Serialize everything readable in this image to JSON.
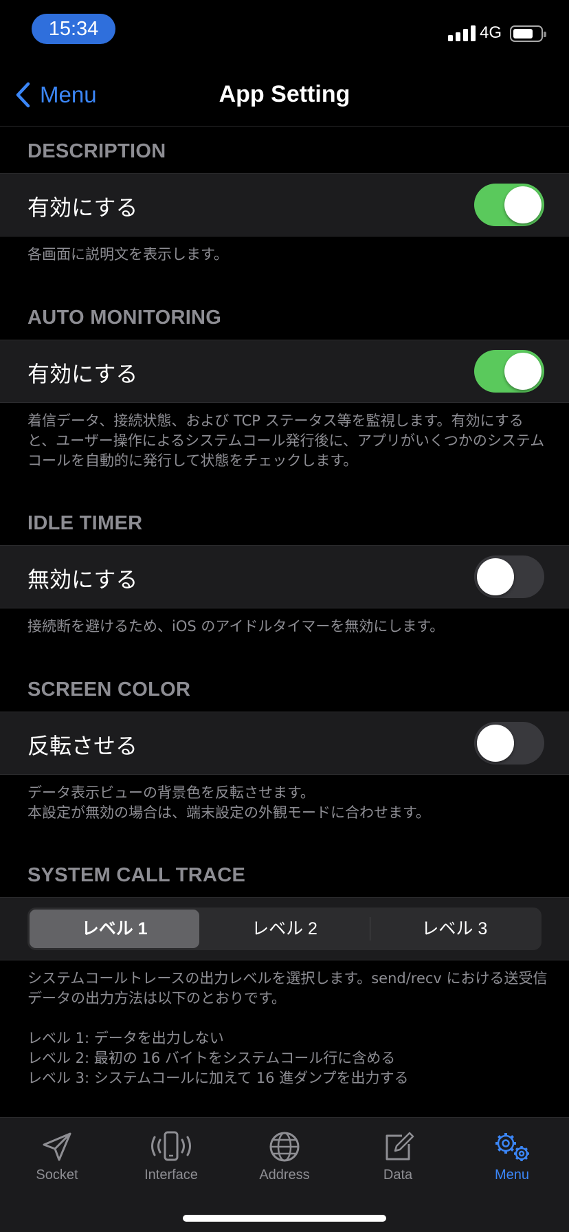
{
  "status_bar": {
    "time": "15:34",
    "network": "4G"
  },
  "nav": {
    "back_label": "Menu",
    "title": "App Setting"
  },
  "sections": {
    "description": {
      "header": "DESCRIPTION",
      "label": "有効にする",
      "toggle_on": true,
      "footer": "各画面に説明文を表示します。"
    },
    "auto_monitoring": {
      "header": "AUTO MONITORING",
      "label": "有効にする",
      "toggle_on": true,
      "footer": "着信データ、接続状態、および TCP ステータス等を監視します。有効にすると、ユーザー操作によるシステムコール発行後に、アプリがいくつかのシステムコールを自動的に発行して状態をチェックします。"
    },
    "idle_timer": {
      "header": "IDLE TIMER",
      "label": "無効にする",
      "toggle_on": false,
      "footer": "接続断を避けるため、iOS のアイドルタイマーを無効にします。"
    },
    "screen_color": {
      "header": "SCREEN COLOR",
      "label": "反転させる",
      "toggle_on": false,
      "footer": "データ表示ビューの背景色を反転させます。\n本設定が無効の場合は、端末設定の外観モードに合わせます。"
    },
    "system_call_trace": {
      "header": "SYSTEM CALL TRACE",
      "segments": [
        "レベル 1",
        "レベル 2",
        "レベル 3"
      ],
      "selected": "レベル 1",
      "footer": "システムコールトレースの出力レベルを選択します。send/recv における送受信データの出力方法は以下のとおりです。\n\nレベル 1: データを出力しない\nレベル 2: 最初の 16 バイトをシステムコール行に含める\nレベル 3: システムコールに加えて 16 進ダンプを出力する"
    }
  },
  "tab_bar": {
    "items": [
      {
        "label": "Socket",
        "icon": "paper-plane-icon"
      },
      {
        "label": "Interface",
        "icon": "phone-signal-icon"
      },
      {
        "label": "Address",
        "icon": "globe-icon"
      },
      {
        "label": "Data",
        "icon": "edit-icon"
      },
      {
        "label": "Menu",
        "icon": "gears-icon"
      }
    ],
    "active": "Menu"
  },
  "colors": {
    "accent": "#3b86f7",
    "toggle_on": "#5ac95c",
    "time_pill": "#2f6fdc"
  }
}
